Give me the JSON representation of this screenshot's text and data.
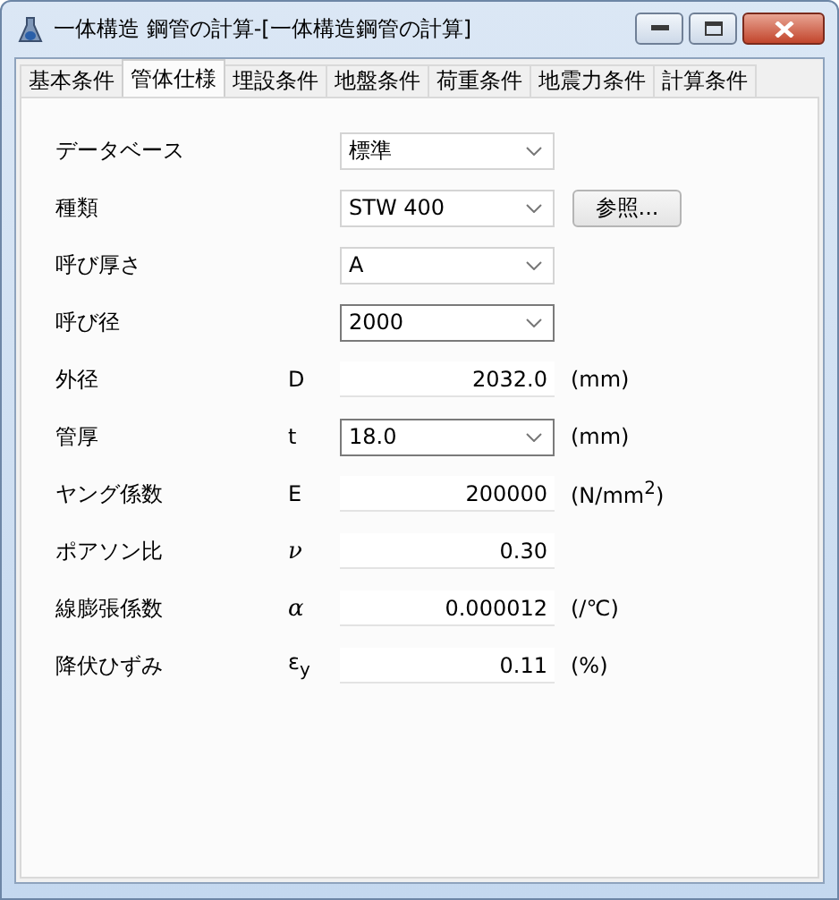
{
  "window": {
    "title": "一体構造 鋼管の計算-[一体構造鋼管の計算]"
  },
  "tabs": [
    {
      "label": "基本条件",
      "selected": false
    },
    {
      "label": "管体仕様",
      "selected": true
    },
    {
      "label": "埋設条件",
      "selected": false
    },
    {
      "label": "地盤条件",
      "selected": false
    },
    {
      "label": "荷重条件",
      "selected": false
    },
    {
      "label": "地震力条件",
      "selected": false
    },
    {
      "label": "計算条件",
      "selected": false
    }
  ],
  "fields": [
    {
      "label": "データベース",
      "kind": "select",
      "value": "標準"
    },
    {
      "label": "種類",
      "kind": "select",
      "value": "STW 400",
      "button": "参照..."
    },
    {
      "label": "呼び厚さ",
      "kind": "select",
      "value": "A"
    },
    {
      "label": "呼び径",
      "kind": "combo",
      "value": "2000"
    },
    {
      "label": "外径",
      "symbol": "D",
      "kind": "input",
      "value": "2032.0",
      "unit": "(mm)"
    },
    {
      "label": "管厚",
      "symbol": "t",
      "kind": "combo",
      "value": "18.0",
      "unit": "(mm)"
    },
    {
      "label": "ヤング係数",
      "symbol": "E",
      "kind": "input",
      "value": "200000",
      "unit": "(N/mm$^{2}$)"
    },
    {
      "label": "ポアソン比",
      "symbol": "ν",
      "symbol_italic": true,
      "kind": "input",
      "value": "0.30"
    },
    {
      "label": "線膨張係数",
      "symbol": "α",
      "symbol_italic": true,
      "kind": "input",
      "value": "0.000012",
      "unit": "(/℃)"
    },
    {
      "label": "降伏ひずみ",
      "symbol": "ε$_{y}$",
      "kind": "input",
      "value": "0.11",
      "unit": "(%)"
    }
  ]
}
